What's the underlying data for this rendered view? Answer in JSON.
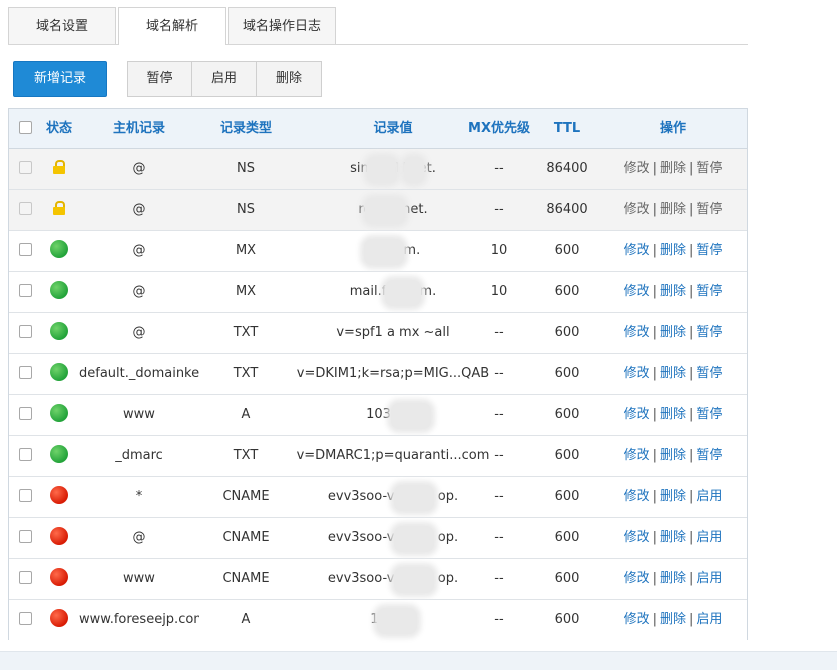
{
  "tabs": [
    {
      "label": "域名设置",
      "active": false
    },
    {
      "label": "域名解析",
      "active": true
    },
    {
      "label": "域名操作日志",
      "active": false
    }
  ],
  "toolbar": {
    "add_label": "新增记录",
    "pause_label": "暂停",
    "enable_label": "启用",
    "delete_label": "删除"
  },
  "table": {
    "headers": {
      "status": "状态",
      "host": "主机记录",
      "type": "记录类型",
      "value": "记录值",
      "mx": "MX优先级",
      "ttl": "TTL",
      "op": "操作"
    },
    "op_labels": {
      "edit": "修改",
      "delete": "删除",
      "pause": "暂停",
      "enable": "启用"
    },
    "rows": [
      {
        "status": "locked",
        "host": "@",
        "type": "NS",
        "value": "sinew.d        l.net.",
        "mx": "--",
        "ttl": "86400",
        "toggle": "暂停"
      },
      {
        "status": "locked",
        "host": "@",
        "type": "NS",
        "value": "rose.         l.net.",
        "mx": "--",
        "ttl": "86400",
        "toggle": "暂停"
      },
      {
        "status": "active",
        "host": "@",
        "type": "MX",
        "value": "fore          om.",
        "mx": "10",
        "ttl": "600",
        "toggle": "暂停"
      },
      {
        "status": "active",
        "host": "@",
        "type": "MX",
        "value": "mail.fore        om.",
        "mx": "10",
        "ttl": "600",
        "toggle": "暂停"
      },
      {
        "status": "active",
        "host": "@",
        "type": "TXT",
        "value": "v=spf1 a mx ~all",
        "mx": "--",
        "ttl": "600",
        "toggle": "暂停"
      },
      {
        "status": "active",
        "host": "default._domainkey",
        "type": "TXT",
        "value": "v=DKIM1;k=rsa;p=MIG...QAB",
        "mx": "--",
        "ttl": "600",
        "toggle": "暂停"
      },
      {
        "status": "active",
        "host": "www",
        "type": "A",
        "value": "103.152",
        "mx": "--",
        "ttl": "600",
        "toggle": "暂停"
      },
      {
        "status": "active",
        "host": "_dmarc",
        "type": "TXT",
        "value": "v=DMARC1;p=quaranti...com",
        "mx": "--",
        "ttl": "600",
        "toggle": "暂停"
      },
      {
        "status": "paused",
        "host": "*",
        "type": "CNAME",
        "value": "evv3soo-v.cnam          op.",
        "mx": "--",
        "ttl": "600",
        "toggle": "启用"
      },
      {
        "status": "paused",
        "host": "@",
        "type": "CNAME",
        "value": "evv3soo-v.cnam          op.",
        "mx": "--",
        "ttl": "600",
        "toggle": "启用"
      },
      {
        "status": "paused",
        "host": "www",
        "type": "CNAME",
        "value": "evv3soo-v.cnam          op.",
        "mx": "--",
        "ttl": "600",
        "toggle": "启用"
      },
      {
        "status": "paused",
        "host": "www.foreseejp.com",
        "type": "A",
        "value": "103.11",
        "mx": "--",
        "ttl": "600",
        "toggle": "启用"
      }
    ]
  },
  "colors": {
    "primary_button": "#1f8ad6",
    "header_text": "#1e73be",
    "header_bg": "#edf3f9",
    "status_active": "#23a33a",
    "status_paused": "#d81b04",
    "status_locked": "#f4c400"
  }
}
